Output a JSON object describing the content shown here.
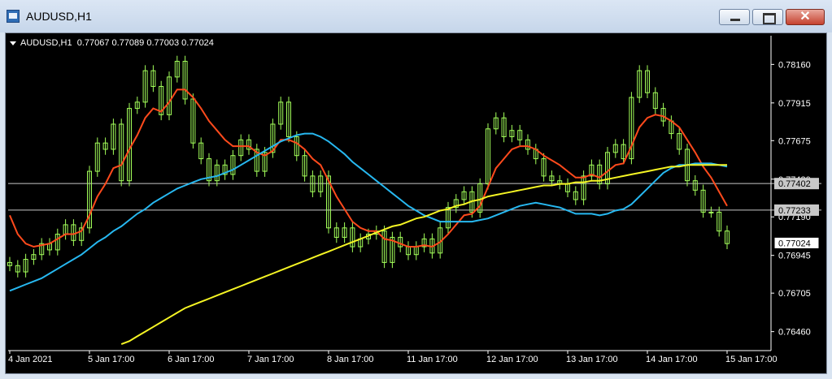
{
  "window": {
    "title": "AUDUSD,H1"
  },
  "header": {
    "symbol_tf": "AUDUSD,H1",
    "ohlc": "0.77067 0.77089 0.77003 0.77024"
  },
  "colors": {
    "background": "#000000",
    "candles": "#a3ff5a",
    "ma_fast": "#ff4a1c",
    "ma_mid": "#27b8f0",
    "ma_slow": "#f5f524",
    "level_line": "#c8c8c8",
    "axis_text": "#ffffff"
  },
  "chart_data": {
    "type": "line",
    "symbol": "AUDUSD",
    "timeframe": "H1",
    "ylim": [
      0.7636,
      0.7826
    ],
    "y_ticks": [
      0.7816,
      0.77915,
      0.77675,
      0.7743,
      0.7719,
      0.76945,
      0.76705,
      0.7646
    ],
    "y_tick_labels": [
      "0.78160",
      "0.77915",
      "0.77675",
      "0.77430",
      "0.77190",
      "0.76945",
      "0.76705",
      "0.76460"
    ],
    "x_ticks": [
      0,
      10,
      20,
      30,
      40,
      50,
      60,
      70,
      80,
      90
    ],
    "x_tick_labels": [
      "4 Jan 2021",
      "5 Jan 17:00",
      "6 Jan 17:00",
      "7 Jan 17:00",
      "8 Jan 17:00",
      "11 Jan 17:00",
      "12 Jan 17:00",
      "13 Jan 17:00",
      "14 Jan 17:00",
      "15 Jan 17:00"
    ],
    "price_levels": [
      {
        "label": "0.77402",
        "value": 0.77402,
        "style": "gray"
      },
      {
        "label": "0.77233",
        "value": 0.77233,
        "style": "gray"
      },
      {
        "label": "0.77024",
        "value": 0.77024,
        "style": "white"
      }
    ],
    "closes": [
      0.7688,
      0.7684,
      0.7692,
      0.7695,
      0.7702,
      0.7698,
      0.7708,
      0.7714,
      0.7704,
      0.7712,
      0.7748,
      0.7766,
      0.7762,
      0.7778,
      0.7742,
      0.7788,
      0.7792,
      0.7812,
      0.7802,
      0.7784,
      0.7808,
      0.7818,
      0.7794,
      0.7766,
      0.7756,
      0.7742,
      0.7752,
      0.7746,
      0.7758,
      0.7768,
      0.7762,
      0.7748,
      0.776,
      0.7778,
      0.7792,
      0.777,
      0.7758,
      0.7745,
      0.7735,
      0.7745,
      0.7712,
      0.7706,
      0.7712,
      0.77,
      0.7705,
      0.7708,
      0.771,
      0.769,
      0.7706,
      0.77,
      0.7695,
      0.77,
      0.7705,
      0.7696,
      0.7712,
      0.7725,
      0.773,
      0.7735,
      0.7722,
      0.774,
      0.7775,
      0.7782,
      0.777,
      0.7774,
      0.7768,
      0.7762,
      0.7756,
      0.7745,
      0.7742,
      0.774,
      0.7735,
      0.773,
      0.7745,
      0.7752,
      0.774,
      0.776,
      0.7765,
      0.7756,
      0.7795,
      0.7812,
      0.7798,
      0.7788,
      0.778,
      0.7772,
      0.7762,
      0.7742,
      0.7736,
      0.7722,
      0.7722,
      0.771,
      0.7702
    ],
    "series": [
      {
        "role": "ma-fast",
        "values": [
          0.772,
          0.7708,
          0.7702,
          0.77,
          0.7701,
          0.7702,
          0.7705,
          0.7708,
          0.7708,
          0.771,
          0.772,
          0.7732,
          0.774,
          0.775,
          0.7752,
          0.7762,
          0.7771,
          0.7782,
          0.7788,
          0.7786,
          0.7792,
          0.78,
          0.78,
          0.7795,
          0.7788,
          0.778,
          0.7774,
          0.7768,
          0.7764,
          0.7764,
          0.7764,
          0.776,
          0.7758,
          0.7761,
          0.7768,
          0.7768,
          0.7766,
          0.7762,
          0.7756,
          0.7752,
          0.7742,
          0.7732,
          0.7724,
          0.7716,
          0.7712,
          0.771,
          0.771,
          0.7705,
          0.7704,
          0.7702,
          0.77,
          0.77,
          0.7701,
          0.77,
          0.7703,
          0.7708,
          0.7714,
          0.772,
          0.7721,
          0.7726,
          0.7738,
          0.775,
          0.7756,
          0.7762,
          0.7764,
          0.7764,
          0.7762,
          0.7758,
          0.7755,
          0.7752,
          0.7748,
          0.7744,
          0.7744,
          0.7746,
          0.7744,
          0.7748,
          0.7752,
          0.7753,
          0.7764,
          0.7776,
          0.7782,
          0.7784,
          0.7783,
          0.778,
          0.7776,
          0.7768,
          0.776,
          0.7751,
          0.7744,
          0.7735,
          0.7726
        ]
      },
      {
        "role": "ma-mid",
        "values": [
          0.7672,
          0.7674,
          0.7676,
          0.7678,
          0.768,
          0.7683,
          0.7686,
          0.7689,
          0.7692,
          0.7695,
          0.7699,
          0.7703,
          0.7706,
          0.771,
          0.7713,
          0.7717,
          0.7721,
          0.7724,
          0.7728,
          0.7731,
          0.7734,
          0.7737,
          0.7739,
          0.7741,
          0.7743,
          0.7744,
          0.7745,
          0.7747,
          0.7749,
          0.7752,
          0.7755,
          0.7758,
          0.7761,
          0.7764,
          0.7767,
          0.7769,
          0.7771,
          0.7772,
          0.7772,
          0.777,
          0.7767,
          0.7763,
          0.7759,
          0.7754,
          0.775,
          0.7746,
          0.7742,
          0.7738,
          0.7734,
          0.773,
          0.7726,
          0.7723,
          0.772,
          0.7718,
          0.7716,
          0.7716,
          0.7716,
          0.7716,
          0.7716,
          0.7717,
          0.7718,
          0.772,
          0.7722,
          0.7724,
          0.7726,
          0.7727,
          0.7728,
          0.7727,
          0.7726,
          0.7725,
          0.7723,
          0.7721,
          0.7721,
          0.7721,
          0.772,
          0.7721,
          0.7723,
          0.7724,
          0.7727,
          0.7732,
          0.7737,
          0.7742,
          0.7747,
          0.775,
          0.7752,
          0.7752,
          0.7753,
          0.7753,
          0.7753,
          0.7752,
          0.7751
        ]
      },
      {
        "role": "ma-slow",
        "values": [
          null,
          null,
          null,
          null,
          null,
          null,
          null,
          null,
          null,
          null,
          null,
          null,
          null,
          null,
          0.7638,
          0.764,
          0.7643,
          0.7646,
          0.7649,
          0.7652,
          0.7655,
          0.7658,
          0.7661,
          0.7663,
          0.7665,
          0.7667,
          0.7669,
          0.7671,
          0.7673,
          0.7675,
          0.7677,
          0.7679,
          0.7681,
          0.7683,
          0.7685,
          0.7687,
          0.7689,
          0.7691,
          0.7693,
          0.7695,
          0.7697,
          0.7699,
          0.7701,
          0.7703,
          0.7705,
          0.7707,
          0.7709,
          0.7711,
          0.7713,
          0.7714,
          0.7716,
          0.7718,
          0.7719,
          0.7721,
          0.7723,
          0.7724,
          0.7726,
          0.7727,
          0.7729,
          0.773,
          0.7732,
          0.7733,
          0.7734,
          0.7735,
          0.7736,
          0.7737,
          0.7738,
          0.7739,
          0.7739,
          0.774,
          0.774,
          0.7741,
          0.7741,
          0.7742,
          0.7742,
          0.7743,
          0.7744,
          0.7745,
          0.7746,
          0.7747,
          0.7748,
          0.7749,
          0.775,
          0.7751,
          0.7751,
          0.7752,
          0.7752,
          0.7752,
          0.7752,
          0.7752,
          0.7752
        ]
      }
    ]
  }
}
